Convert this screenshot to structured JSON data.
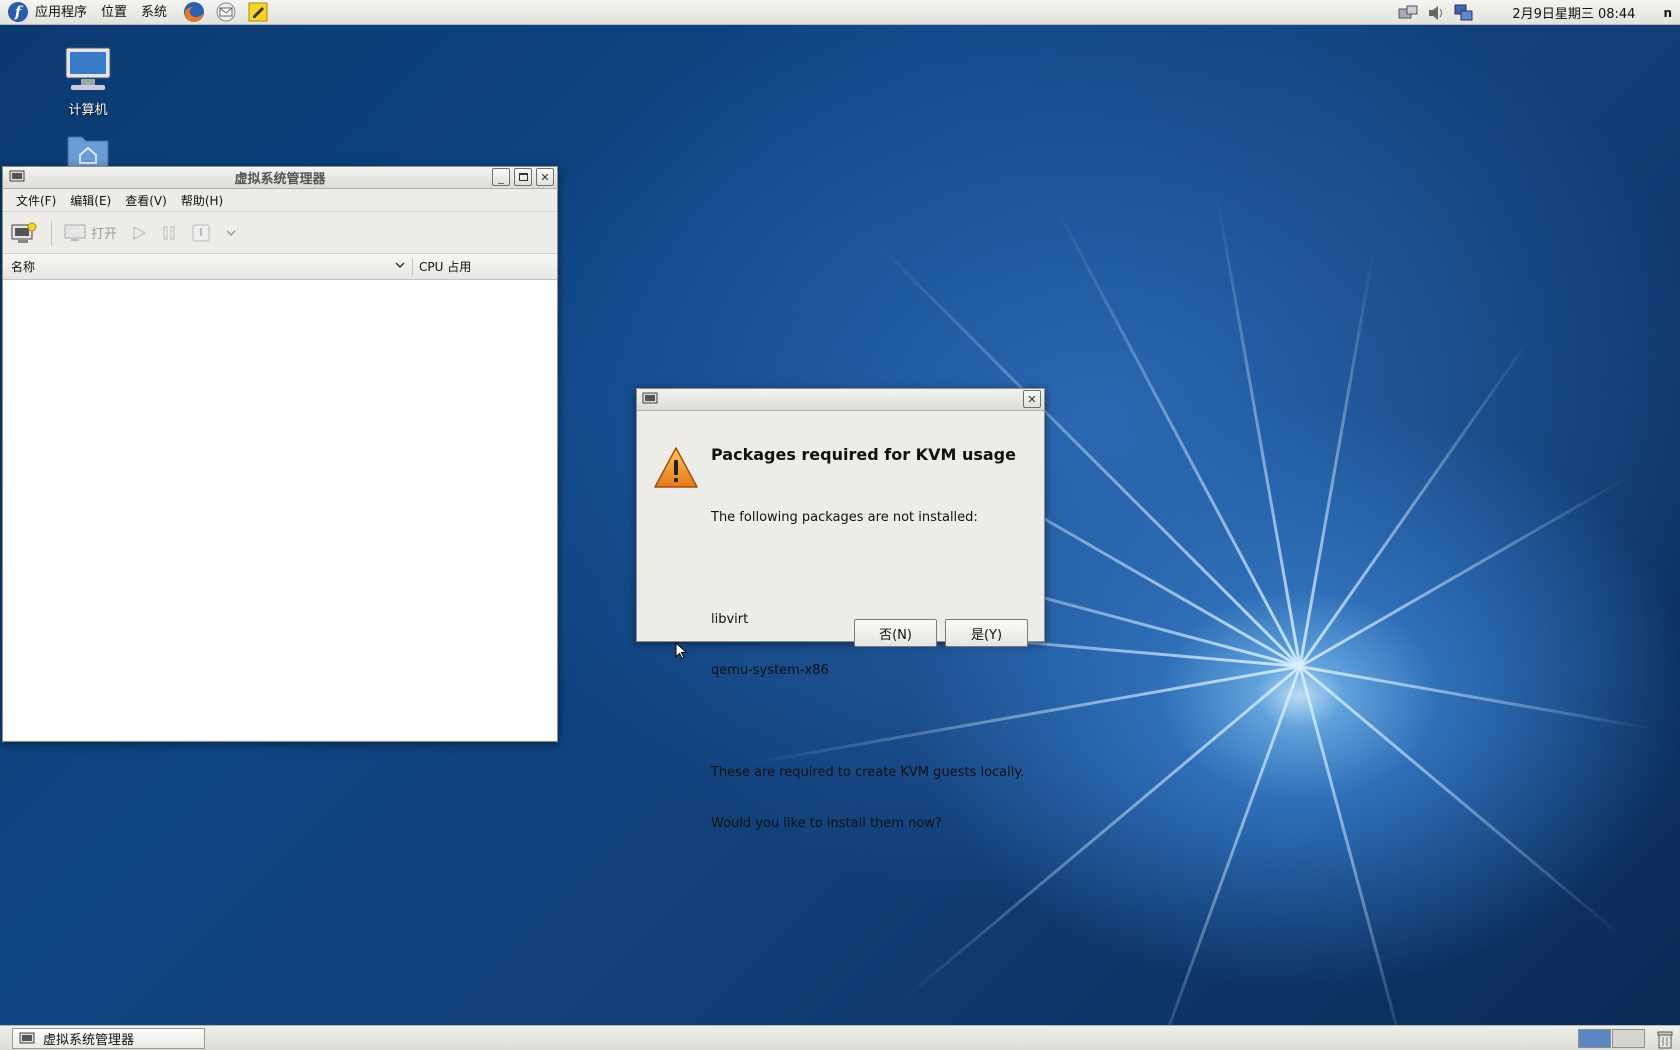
{
  "top_panel": {
    "menus": [
      "应用程序",
      "位置",
      "系统"
    ],
    "clock": "2月9日星期三 08:44",
    "user": "n"
  },
  "desktop": {
    "icons": [
      {
        "label": "计算机"
      }
    ]
  },
  "vm_window": {
    "title": "虚拟系统管理器",
    "menus": [
      "文件(F)",
      "编辑(E)",
      "查看(V)",
      "帮助(H)"
    ],
    "toolbar": {
      "open_label": "打开"
    },
    "columns": {
      "name": "名称",
      "cpu": "CPU 占用"
    }
  },
  "dialog": {
    "heading": "Packages required for KVM usage",
    "line1": "The following packages are not installed:",
    "packages": [
      "libvirt",
      "qemu-system-x86"
    ],
    "line2": "These are required to create KVM guests locally.",
    "line3": "Would you like to install them now?",
    "no_label": "否(N)",
    "yes_label": "是(Y)"
  },
  "taskbar": {
    "task_label": "虚拟系统管理器"
  }
}
